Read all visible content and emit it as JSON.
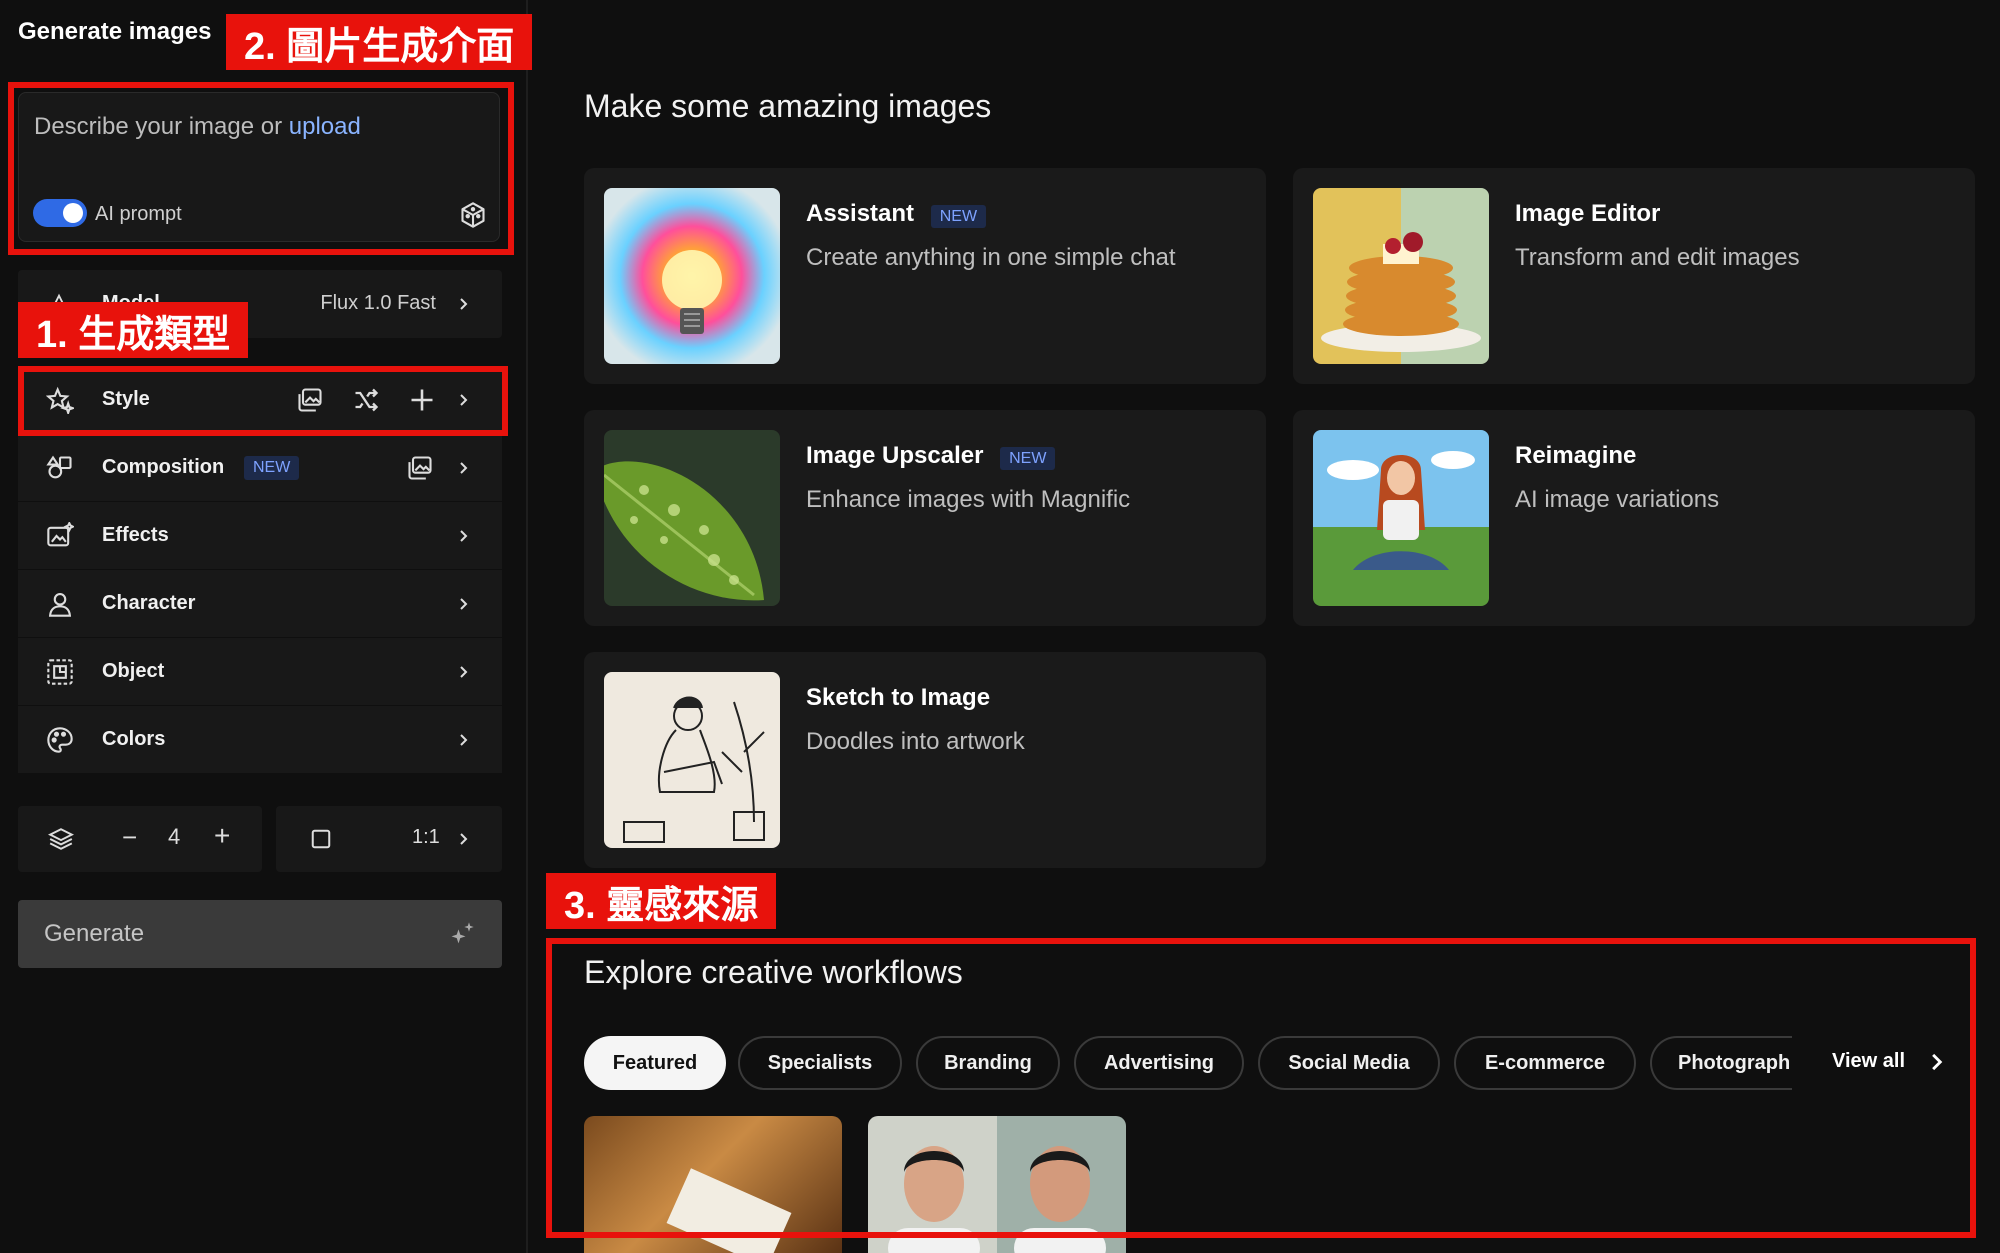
{
  "sidebar": {
    "title": "Generate images",
    "prompt": {
      "placeholder": "Describe your image or",
      "upload_link": "upload",
      "ai_prompt_label": "AI prompt",
      "ai_prompt_enabled": true
    },
    "model": {
      "label": "Model",
      "value": "Flux 1.0 Fast"
    },
    "options": [
      {
        "label": "Style",
        "icon": "star-sparkle-icon"
      },
      {
        "label": "Composition",
        "badge": "NEW",
        "icon": "shapes-icon"
      },
      {
        "label": "Effects",
        "icon": "image-sparkle-icon"
      },
      {
        "label": "Character",
        "icon": "person-icon"
      },
      {
        "label": "Object",
        "icon": "object-icon"
      },
      {
        "label": "Colors",
        "icon": "palette-icon"
      }
    ],
    "count": {
      "value": "4",
      "minus": "−",
      "plus": "+"
    },
    "aspect_ratio": "1:1",
    "generate_label": "Generate"
  },
  "main": {
    "heading": "Make some amazing images",
    "tools": [
      {
        "title": "Assistant",
        "badge": "NEW",
        "desc": "Create anything in one simple chat"
      },
      {
        "title": "Image Editor",
        "desc": "Transform and edit images"
      },
      {
        "title": "Image Upscaler",
        "badge": "NEW",
        "desc": "Enhance images with Magnific"
      },
      {
        "title": "Reimagine",
        "desc": "AI image variations"
      },
      {
        "title": "Sketch to Image",
        "desc": "Doodles into artwork"
      }
    ],
    "workflows": {
      "heading": "Explore creative workflows",
      "tabs": [
        "Featured",
        "Specialists",
        "Branding",
        "Advertising",
        "Social Media",
        "E-commerce",
        "Photograph"
      ],
      "active_tab": "Featured",
      "view_all": "View all"
    }
  },
  "annotations": {
    "label_1": "1. 生成類型",
    "label_2": "2. 圖片生成介面",
    "label_3": "3. 靈感來源",
    "color": "#e8120c"
  },
  "colors": {
    "accent": "#2f6ae5",
    "badge_text": "#7ea2ff",
    "annotation_red": "#e8120c"
  }
}
